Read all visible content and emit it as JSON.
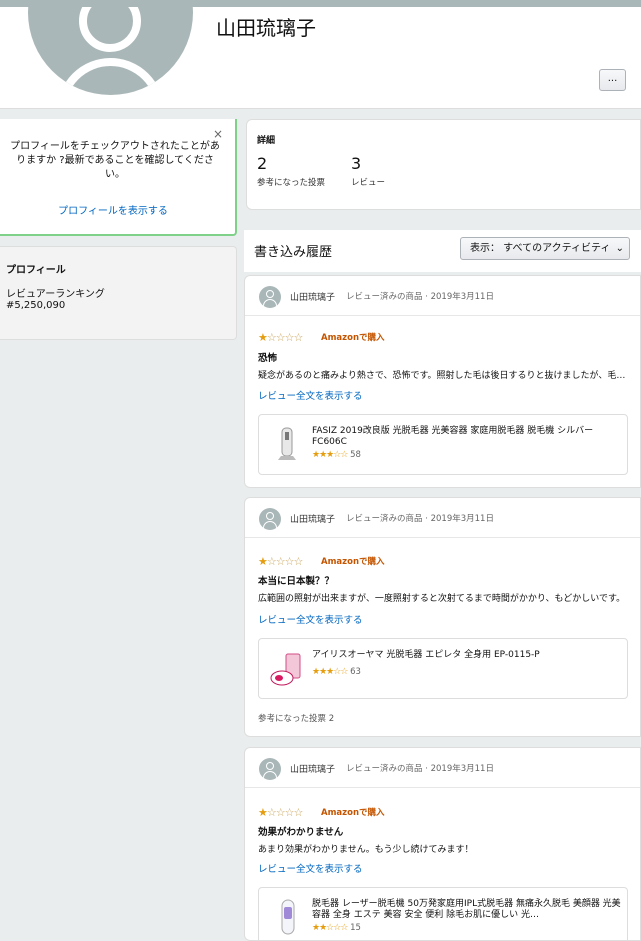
{
  "header": {
    "name": "山田琉璃子",
    "more_label": "..."
  },
  "notice": {
    "close": "×",
    "message": "プロフィールをチェックアウトされたことがありますか ?最新であることを確認してください。",
    "link": "プロフィールを表示する"
  },
  "details": {
    "title": "詳細",
    "helpful_count": "2",
    "helpful_label": "参考になった投票",
    "review_count": "3",
    "review_label": "レビュー"
  },
  "side_profile": {
    "title": "プロフィール",
    "rank_label": "レビュアーランキング",
    "rank_value": "#5,250,090"
  },
  "history": {
    "title": "書き込み履歴",
    "filter_label": "表示： すべてのアクティビティ"
  },
  "reviews": [
    {
      "author": "山田琉璃子",
      "meta": "レビュー済みの商品 · 2019年3月11日",
      "rating": 1,
      "verified": "Amazonで購入",
      "title": "恐怖",
      "body": "疑念があるのと痛みより熱さで、恐怖です。照射した毛は後日するりと抜けましたが、毛の量が多すぎて全部はとても無理です。",
      "link": "レビュー全文を表示する",
      "product_name": "FASIZ 2019改良版 光脱毛器 光美容器 家庭用脱毛器 脱毛機 シルバー FC606C",
      "product_rating": 3,
      "product_count": "58",
      "helpful": ""
    },
    {
      "author": "山田琉璃子",
      "meta": "レビュー済みの商品 · 2019年3月11日",
      "rating": 1,
      "verified": "Amazonで購入",
      "title": "本当に日本製？？",
      "body": "広範囲の照射が出来ますが、一度照射すると次射てるまで時間がかかり、もどかしいです。",
      "link": "レビュー全文を表示する",
      "product_name": "アイリスオーヤマ 光脱毛器 エピレタ 全身用 EP-0115-P",
      "product_rating": 3,
      "product_count": "63",
      "helpful": "参考になった投票 2"
    },
    {
      "author": "山田琉璃子",
      "meta": "レビュー済みの商品 · 2019年3月11日",
      "rating": 1,
      "verified": "Amazonで購入",
      "title": "効果がわかりません",
      "body": "あまり効果がわかりません。もう少し続けてみます！",
      "link": "レビュー全文を表示する",
      "product_name": "脱毛器 レーザー脱毛機 50万発家庭用IPL式脱毛器 無痛永久脱毛 美顔器 光美容器 全身 エステ 美容 安全 便利 除毛お肌に優しい 光…",
      "product_rating": 2,
      "product_count": "15",
      "helpful": ""
    }
  ],
  "colors": {
    "link": "#0066c0",
    "star": "#e59c0e",
    "verified": "#c45500",
    "notice_border": "#7fd18a",
    "avatar": "#aab7b8"
  }
}
